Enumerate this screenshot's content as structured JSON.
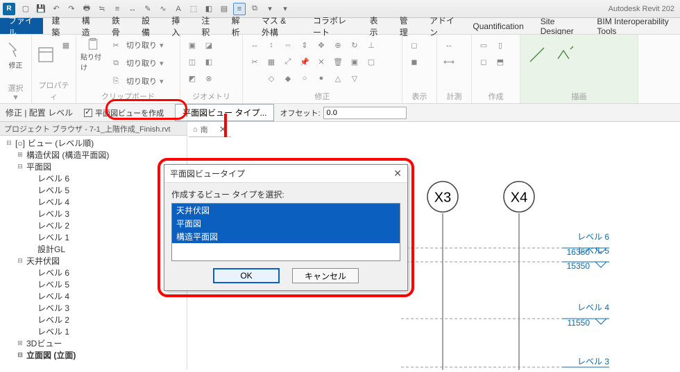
{
  "app": {
    "title": "Autodesk Revit 202",
    "logo_letter": "R"
  },
  "qat_icons": [
    "open",
    "save",
    "undo",
    "redo",
    "print",
    "pipe",
    "angle",
    "lamp",
    "text",
    "3d",
    "section",
    "plan",
    "thin",
    "dash",
    "image",
    "soffit",
    "dropdown"
  ],
  "tabs": {
    "file": "ファイル",
    "list": [
      "建築",
      "構造",
      "鉄骨",
      "設備",
      "挿入",
      "注釈",
      "解析",
      "マス & 外構",
      "コラボレート",
      "表示",
      "管理",
      "アドイン",
      "Quantification",
      "Site Designer",
      "BIM Interoperability Tools"
    ]
  },
  "ribbon_panels": {
    "select": {
      "label": "選択 ▼",
      "btn": "修正"
    },
    "properties": {
      "label": "プロパティ"
    },
    "clipboard": {
      "label": "クリップボード",
      "paste": "貼り付け",
      "cut": "切り取り",
      "copy": "切り取り",
      "c2": "切り取り"
    },
    "geometry": {
      "label": "ジオメトリ"
    },
    "modify": {
      "label": "修正"
    },
    "view": {
      "label": "表示"
    },
    "measure": {
      "label": "計測"
    },
    "create": {
      "label": "作成"
    },
    "draw": {
      "label": "描画"
    }
  },
  "contextbar": {
    "title": "修正 | 配置 レベル",
    "checkbox_label": "平面図ビューを作成",
    "btn_plantype": "平面図ビュー タイプ...",
    "offset_label": "オフセット:",
    "offset_value": "0.0"
  },
  "view_tab": {
    "label": "南",
    "home_icon": "⌂"
  },
  "browser": {
    "header": "プロジェクト ブラウザ - 7-1_上階作成_Finish.rvt",
    "root": "ビュー (レベル順)",
    "nodes": {
      "struct_fp": "構造伏図 (構造平面図)",
      "plan": "平面図",
      "plan_children": [
        "レベル 6",
        "レベル 5",
        "レベル 4",
        "レベル 3",
        "レベル 2",
        "レベル 1",
        "設計GL"
      ],
      "ceil": "天井伏図",
      "ceil_children": [
        "レベル 6",
        "レベル 5",
        "レベル 4",
        "レベル 3",
        "レベル 2",
        "レベル 1"
      ],
      "3d": "3Dビュー",
      "elev": "立面図 (立面)"
    }
  },
  "canvas": {
    "bubbles": [
      "X3",
      "X4"
    ],
    "levels": [
      {
        "name": "レベル 6",
        "val": "16350"
      },
      {
        "name": "レベル 5",
        "val": "15350"
      },
      {
        "name": "レベル 4",
        "val": "11550"
      },
      {
        "name": "レベル 3",
        "val": ""
      }
    ]
  },
  "dialog": {
    "title": "平面図ビュータイプ",
    "label": "作成するビュー タイプを選択:",
    "items": [
      "天井伏図",
      "平面図",
      "構造平面図"
    ],
    "ok": "OK",
    "cancel": "キャンセル"
  }
}
